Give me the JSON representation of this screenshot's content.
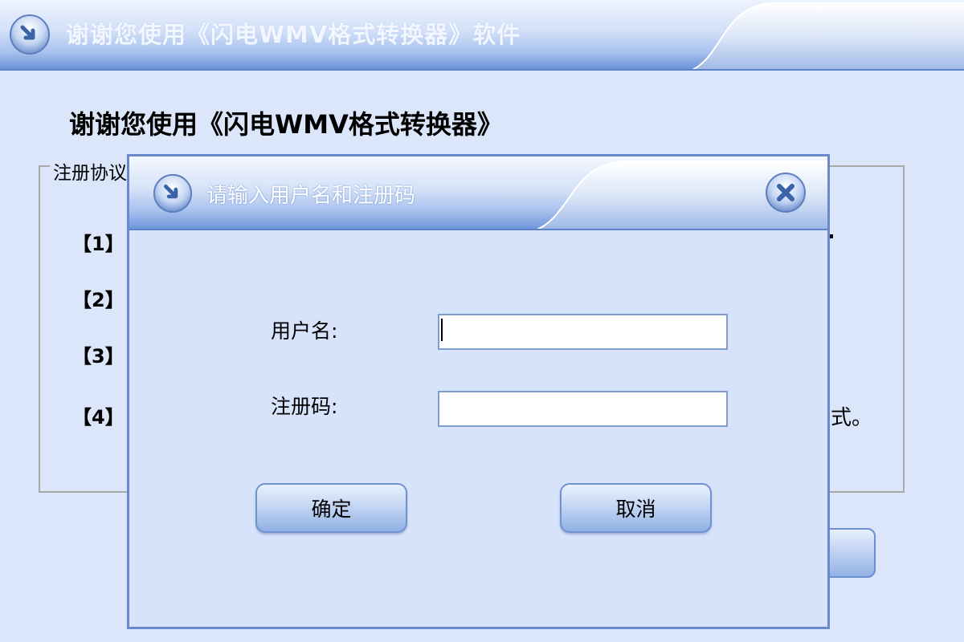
{
  "main_window": {
    "title": "谢谢您使用《闪电WMV格式转换器》软件",
    "heading": "谢谢您使用《闪电WMV格式转换器》",
    "groupbox_label": "注册协议",
    "items": [
      "【1】",
      "【2】",
      "【3】",
      "【4】"
    ],
    "item4_tail": "式。"
  },
  "dialog": {
    "title": "请输入用户名和注册码",
    "username_label": "用户名:",
    "username_value": "",
    "regcode_label": "注册码:",
    "regcode_value": "",
    "ok_label": "确定",
    "cancel_label": "取消"
  },
  "colors": {
    "background": "#dbe6fa",
    "title_gradient_dark": "#6b93d9",
    "border": "#6b88cc"
  },
  "icons": {
    "title_icon": "arrow-orb-icon",
    "close_icon": "close-x-icon"
  }
}
